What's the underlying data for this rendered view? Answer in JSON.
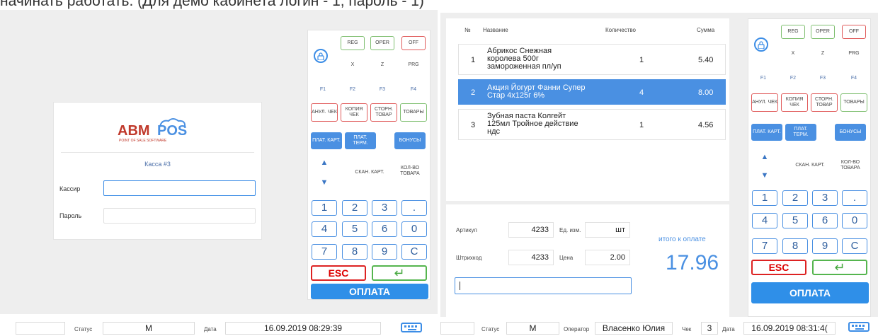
{
  "caption": "начинать работать. (Для демо кабинета логин - 1, пароль - 1)",
  "login": {
    "logo_text": "ABMPOS",
    "logo_sub": "POINT OF SALE SOFTWARE",
    "kassa": "Касса #3",
    "cashier_label": "Кассир",
    "password_label": "Пароль",
    "cashier_value": "",
    "password_value": ""
  },
  "keypad": {
    "reg": "REG",
    "oper": "OPER",
    "off": "OFF",
    "x": "X",
    "z": "Z",
    "prg": "PRG",
    "f1": "F1",
    "f2": "F2",
    "f3": "F3",
    "f4": "F4",
    "cancel_check": "АНУЛ. ЧЕК",
    "copy_check": "КОПИЯ ЧЕК",
    "storno": "СТОРН. ТОВАР",
    "goods": "ТОВАРЫ",
    "pay_card": "ПЛАТ. КАРТ.",
    "pay_term": "ПЛАТ. ТЕРМ.",
    "bonuses": "БОНУСЫ",
    "scan_card": "СКАН. КАРТ.",
    "qty": "КОЛ-ВО ТОВАРА",
    "up": "▲",
    "down": "▼",
    "digits": [
      "1",
      "2",
      "3",
      ".",
      "4",
      "5",
      "6",
      "0",
      "7",
      "8",
      "9",
      "C"
    ],
    "esc": "ESC",
    "enter": "↵",
    "pay": "ОПЛАТА",
    "lock_icon": "lock-icon"
  },
  "receipt": {
    "headers": {
      "num": "№",
      "name": "Название",
      "qty": "Количество",
      "sum": "Сумма"
    },
    "rows": [
      {
        "num": "1",
        "name": "Абрикос Снежная королева 500г замороженная пл/уп",
        "qty": "1",
        "sum": "5.40"
      },
      {
        "num": "2",
        "name": "Акция Йогурт Фанни Супер Стар 4х125г 6%",
        "qty": "4",
        "sum": "8.00"
      },
      {
        "num": "3",
        "name": "Зубная паста Колгейт 125мл Тройное действие ндс",
        "qty": "1",
        "sum": "4.56"
      }
    ]
  },
  "totals": {
    "article_label": "Артикул",
    "article": "4233",
    "unit_label": "Ед. изм.",
    "unit": "шт",
    "barcode_label": "Штрихкод",
    "barcode": "4233",
    "price_label": "Цена",
    "price": "2.00",
    "total_label": "итого к оплате",
    "total": "17.96"
  },
  "status_left": {
    "status_label": "Статус",
    "status": "M",
    "date_label": "Дата",
    "date": "16.09.2019 08:29:39"
  },
  "status_right": {
    "status_label": "Статус",
    "status": "M",
    "operator_label": "Оператор",
    "operator": "Власенко Юлия",
    "check_label": "Чек",
    "check": "3",
    "date_label": "Дата",
    "date": "16.09.2019 08:31:4("
  },
  "colors": {
    "accent": "#4a90e2",
    "esc": "#dd2222",
    "enter": "#55b54e"
  }
}
